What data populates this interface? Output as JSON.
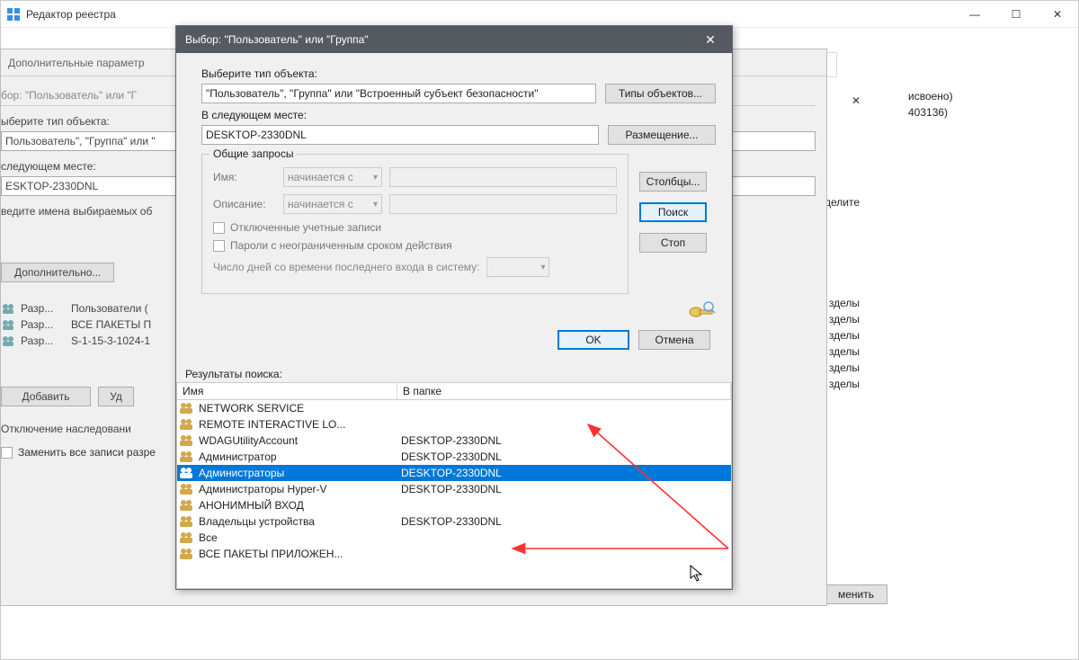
{
  "main_window": {
    "title": "Редактор реестра"
  },
  "adv_window": {
    "title": "Дополнительные параметр",
    "breadcrumb": "бор: \"Пользователь\" или \"Г",
    "select_type_label": "ыберите тип объекта:",
    "select_type_value": "Пользователь\", \"Группа\" или \"",
    "location_label": "следующем месте:",
    "location_value": "ESKTOP-2330DNL",
    "enter_names_label": "ведите имена выбираемых об",
    "additional_btn": "Дополнительно...",
    "perm_rows": [
      {
        "type": "Разр...",
        "principal": "Пользователи ("
      },
      {
        "type": "Разр...",
        "principal": "ВСЕ ПАКЕТЫ П"
      },
      {
        "type": "Разр...",
        "principal": "S-1-15-3-1024-1"
      }
    ],
    "add_btn": "Добавить",
    "remove_btn": "Уд",
    "inherit_label": "Отключение наследовани",
    "replace_label": "Заменить все записи разре"
  },
  "sel_dialog": {
    "title": "Выбор: \"Пользователь\" или \"Группа\"",
    "obj_type_label": "Выберите тип объекта:",
    "obj_type_value": "\"Пользователь\", \"Группа\" или \"Встроенный субъект безопасности\"",
    "obj_type_btn": "Типы объектов...",
    "location_label": "В следующем месте:",
    "location_value": "DESKTOP-2330DNL",
    "location_btn": "Размещение...",
    "common_queries": "Общие запросы",
    "name_label": "Имя:",
    "desc_label": "Описание:",
    "starts_with": "начинается с",
    "disabled_chk": "Отключенные учетные записи",
    "nonexp_chk": "Пароли с неограниченным сроком действия",
    "days_label": "Число дней со времени последнего входа в систему:",
    "columns_btn": "Столбцы...",
    "search_btn": "Поиск",
    "stop_btn": "Стоп",
    "ok_btn": "OK",
    "cancel_btn": "Отмена",
    "results_label": "Результаты поиска:",
    "col_name": "Имя",
    "col_folder": "В папке",
    "results": [
      {
        "name": "NETWORK SERVICE",
        "folder": ""
      },
      {
        "name": "REMOTE INTERACTIVE LO...",
        "folder": ""
      },
      {
        "name": "WDAGUtilityAccount",
        "folder": "DESKTOP-2330DNL"
      },
      {
        "name": "Администратор",
        "folder": "DESKTOP-2330DNL"
      },
      {
        "name": "Администраторы",
        "folder": "DESKTOP-2330DNL",
        "selected": true
      },
      {
        "name": "Администраторы Hyper-V",
        "folder": "DESKTOP-2330DNL"
      },
      {
        "name": "АНОНИМНЫЙ ВХОД",
        "folder": ""
      },
      {
        "name": "Владельцы устройства",
        "folder": "DESKTOP-2330DNL"
      },
      {
        "name": "Все",
        "folder": ""
      },
      {
        "name": "ВСЕ ПАКЕТЫ ПРИЛОЖЕН...",
        "folder": ""
      }
    ]
  },
  "right_panel": {
    "items": [
      "исвоено)",
      "403136)",
      "делите",
      "зделы",
      "зделы",
      "зделы",
      "зделы",
      "зделы",
      "зделы"
    ],
    "apply_btn": "менить"
  }
}
